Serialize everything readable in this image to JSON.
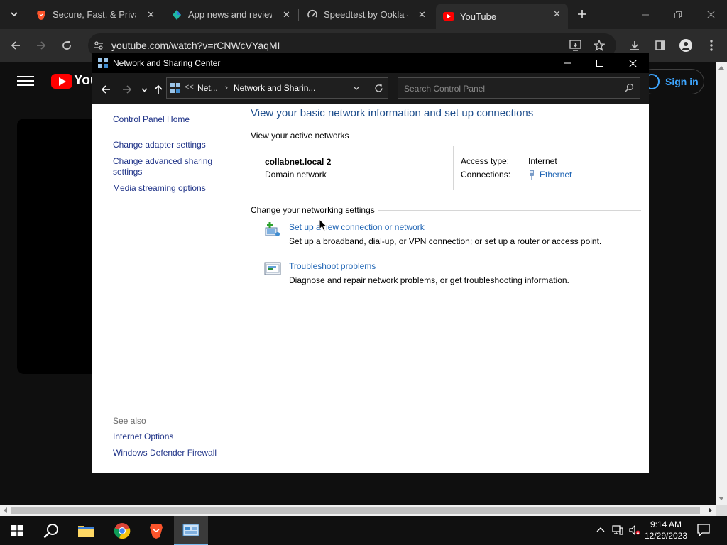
{
  "browser": {
    "tabs": [
      {
        "title": "Secure, Fast, & Private",
        "icon": "brave-lion-icon"
      },
      {
        "title": "App news and reviews",
        "icon": "app-diamond-icon"
      },
      {
        "title": "Speedtest by Ookla - T",
        "icon": "speedtest-gauge-icon"
      },
      {
        "title": "YouTube",
        "icon": "youtube-play-icon",
        "active": true
      }
    ],
    "url": "youtube.com/watch?v=rCNWcVYaqMI",
    "accent": "#1f1f1f"
  },
  "youtube": {
    "wordmark": "You",
    "signin_label": "Sign in",
    "accent": "#ff0000",
    "link_color": "#3ea6ff"
  },
  "window": {
    "title": "Network and Sharing Center",
    "breadcrumb": {
      "overflow": "<<",
      "parent": "Net...",
      "current": "Network and Sharin..."
    },
    "search_placeholder": "Search Control Panel"
  },
  "sidebar": {
    "home": "Control Panel Home",
    "links": [
      "Change adapter settings",
      "Change advanced sharing settings",
      "Media streaming options"
    ],
    "see_also_label": "See also",
    "see_also_links": [
      "Internet Options",
      "Windows Defender Firewall"
    ]
  },
  "main": {
    "title": "View your basic network information and set up connections",
    "active_networks_header": "View your active networks",
    "network": {
      "name": "collabnet.local 2",
      "category": "Domain network",
      "access_type_label": "Access type:",
      "access_type_value": "Internet",
      "connections_label": "Connections:",
      "connection_link": "Ethernet"
    },
    "change_settings_header": "Change your networking settings",
    "tasks": [
      {
        "link": "Set up a new connection or network",
        "description": "Set up a broadband, dial-up, or VPN connection; or set up a router or access point."
      },
      {
        "link": "Troubleshoot problems",
        "description": "Diagnose and repair network problems, or get troubleshooting information."
      }
    ],
    "title_color": "#1e4e8c",
    "link_color": "#1e64b4"
  },
  "taskbar": {
    "time": "9:14 AM",
    "date": "12/29/2023"
  }
}
